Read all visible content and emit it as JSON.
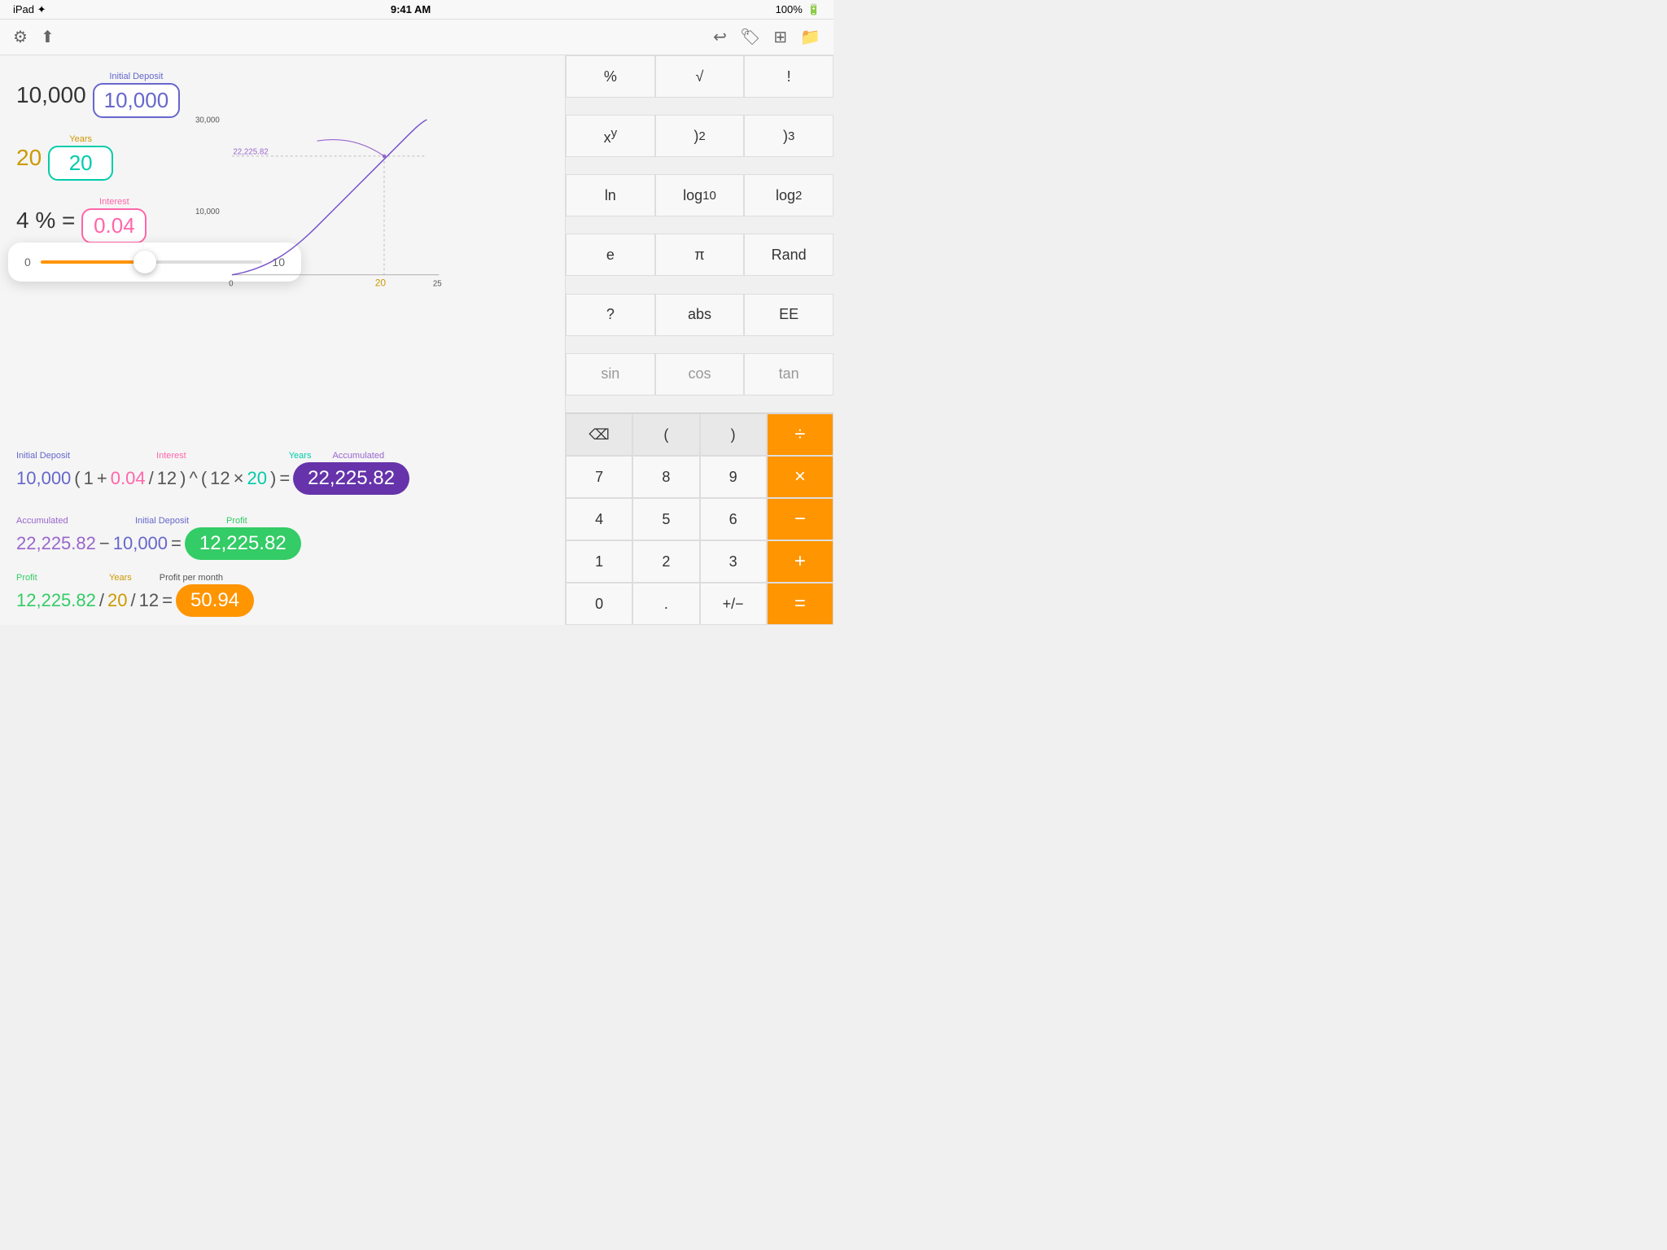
{
  "statusBar": {
    "left": "iPad ✦",
    "time": "9:41 AM",
    "battery": "100%"
  },
  "toolbar": {
    "icons": [
      "⚙",
      "↑",
      "",
      "",
      "",
      ""
    ]
  },
  "variables": {
    "initialDeposit": {
      "label": "Initial Deposit",
      "displayValue": "10,000",
      "inputValue": "10,000"
    },
    "years": {
      "label": "Years",
      "displayValue": "20",
      "inputValue": "20"
    },
    "interest": {
      "label": "Interest",
      "displayPct": "4 %",
      "displayValue": "4",
      "inputValue": "0.04"
    }
  },
  "slider": {
    "min": "0",
    "max": "10",
    "value": "4"
  },
  "graph": {
    "yLabels": [
      "30,000",
      "10,000"
    ],
    "xLabels": [
      "0",
      "25"
    ],
    "annotationValue": "22,225.82",
    "xAnnotation": "20"
  },
  "formula1": {
    "labels": {
      "initialDeposit": "Initial Deposit",
      "interest": "Interest",
      "years": "Years",
      "accumulated": "Accumulated"
    },
    "expression": "10,000 ( 1 + 0.04 / 12 ) ^ ( 12 × 20 ) =",
    "result": "22,225.82"
  },
  "formula2": {
    "labels": {
      "accumulated": "Accumulated",
      "initialDeposit": "Initial Deposit",
      "profit": "Profit"
    },
    "expression": "22,225.82 − 10,000 =",
    "result": "12,225.82"
  },
  "formula3": {
    "labels": {
      "profit": "Profit",
      "years": "Years",
      "profitPerMonth": "Profit per month"
    },
    "expression": "12,225.82 / 20 / 12 =",
    "result": "50.94"
  },
  "calculator": {
    "functions": [
      "%",
      "√",
      "!",
      "xʸ",
      ")²",
      ")³",
      "ln",
      "log₁₀",
      "log₂",
      "e",
      "π",
      "Rand",
      "?",
      "abs",
      "EE",
      "sin",
      "cos",
      "tan"
    ],
    "bottomRow": [
      "⌫",
      "(",
      ")",
      "÷"
    ],
    "numpad": [
      "7",
      "8",
      "9",
      "×",
      "4",
      "5",
      "6",
      "−",
      "1",
      "2",
      "3",
      "+",
      "0",
      ".",
      "+/−",
      "="
    ]
  }
}
